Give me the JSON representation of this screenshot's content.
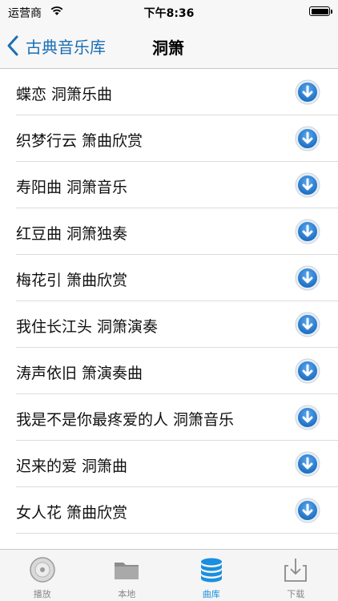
{
  "status": {
    "carrier": "运营商",
    "time": "下午8:36"
  },
  "nav": {
    "back_label": "古典音乐库",
    "title": "洞箫"
  },
  "songs": [
    "蝶恋 洞箫乐曲",
    "织梦行云 箫曲欣赏",
    "寿阳曲 洞箫音乐",
    "红豆曲 洞箫独奏",
    "梅花引 箫曲欣赏",
    "我住长江头 洞箫演奏",
    "涛声依旧 箫演奏曲",
    "我是不是你最疼爱的人 洞箫音乐",
    "迟来的爱 洞箫曲",
    "女人花 箫曲欣赏"
  ],
  "tabs": [
    {
      "label": "播放",
      "icon": "disc-icon"
    },
    {
      "label": "本地",
      "icon": "folder-icon"
    },
    {
      "label": "曲库",
      "icon": "database-icon"
    },
    {
      "label": "下载",
      "icon": "download-tray-icon"
    }
  ],
  "colors": {
    "accent": "#1a6fb5",
    "download_button": "#2b86d6",
    "active_tab": "#1a8fe0"
  }
}
